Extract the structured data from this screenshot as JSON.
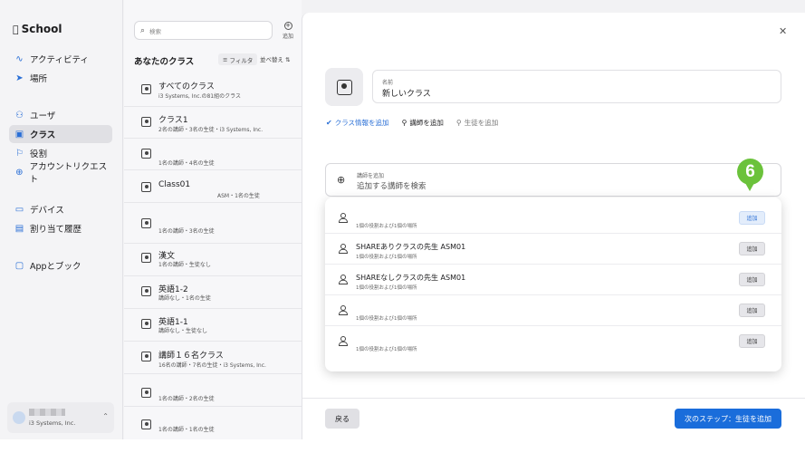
{
  "app": {
    "title": "School"
  },
  "sidebar": {
    "items": [
      {
        "label": "アクティビティ",
        "icon": "activity-icon"
      },
      {
        "label": "場所",
        "icon": "location-arrow-icon"
      },
      {
        "label": "ユーザ",
        "icon": "users-icon"
      },
      {
        "label": "クラス",
        "icon": "class-icon",
        "active": true
      },
      {
        "label": "役割",
        "icon": "flag-icon"
      },
      {
        "label": "アカウントリクエスト",
        "icon": "account-request-icon"
      },
      {
        "label": "デバイス",
        "icon": "laptop-icon"
      },
      {
        "label": "割り当て履歴",
        "icon": "history-icon"
      },
      {
        "label": "Appとブック",
        "icon": "app-icon"
      }
    ],
    "account": {
      "org": "i3 Systems, Inc."
    }
  },
  "classlist": {
    "search_placeholder": "検索",
    "add_label": "追加",
    "title": "あなたのクラス",
    "filter_label": "フィルタ",
    "sort_label": "並べ替え",
    "rows": [
      {
        "name": "すべてのクラス",
        "sub": "i3 Systems, Inc.の81組のクラス"
      },
      {
        "name": "クラス1",
        "sub": "2名の講師・3名の生徒・i3 Systems, Inc."
      },
      {
        "name": "",
        "sub": "1名の講師・4名の生徒"
      },
      {
        "name": "Class01",
        "sub": "ASM・1名の生徒"
      },
      {
        "name": "",
        "sub": "1名の講師・3名の生徒"
      },
      {
        "name": "漢文",
        "sub": "1名の講師・生徒なし"
      },
      {
        "name": "英語1-2",
        "sub": "講師なし・1名の生徒"
      },
      {
        "name": "英語1-1",
        "sub": "講師なし・生徒なし"
      },
      {
        "name": "講師１６名クラス",
        "sub": "16名の講師・7名の生徒・i3 Systems, Inc."
      },
      {
        "name": "",
        "sub": "1名の講師・2名の生徒"
      },
      {
        "name": "",
        "sub": "1名の講師・1名の生徒"
      }
    ]
  },
  "panel": {
    "name_label": "名前",
    "name_value": "新しいクラス",
    "steps": [
      {
        "label": "クラス情報を追加",
        "state": "done"
      },
      {
        "label": "講師を追加",
        "state": "current"
      },
      {
        "label": "生徒を追加",
        "state": "pending"
      }
    ],
    "teacher_search": {
      "label": "講師を追加",
      "placeholder": "追加する講師を検索"
    },
    "results": [
      {
        "name": "",
        "sub": "1個の役割および1個の場所",
        "button": "追加",
        "highlight": true
      },
      {
        "name": "SHAREありクラスの先生 ASM01",
        "sub": "1個の役割および1個の場所",
        "button": "追加"
      },
      {
        "name": "SHAREなしクラスの先生 ASM01",
        "sub": "1個の役割および1個の場所",
        "button": "追加"
      },
      {
        "name": "",
        "sub": "1個の役割および1個の場所",
        "button": "追加"
      },
      {
        "name": "",
        "sub": "1個の役割および1個の場所",
        "button": "追加"
      }
    ],
    "back_label": "戻る",
    "next_label": "次のステップ：生徒を追加",
    "callout": "6"
  },
  "colors": {
    "accent": "#1a6ddb",
    "callout": "#6bc23b"
  }
}
